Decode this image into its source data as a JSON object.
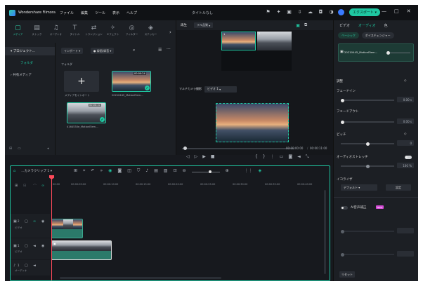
{
  "app": {
    "name": "Wondershare Filmora",
    "doc_title": "タイトルなし",
    "upgrade_label": "エクスポート"
  },
  "menu": [
    "ファイル",
    "編集",
    "ツール",
    "表示",
    "ヘルプ"
  ],
  "window_controls": [
    "—",
    "□",
    "✕"
  ],
  "toolbar_tools": [
    {
      "label": "メディア",
      "icon": "media-icon",
      "glyph": "▢"
    },
    {
      "label": "ストック",
      "icon": "stock-icon",
      "glyph": "▤"
    },
    {
      "label": "オーディオ",
      "icon": "audio-icon",
      "glyph": "♫"
    },
    {
      "label": "タイトル",
      "icon": "title-icon",
      "glyph": "T"
    },
    {
      "label": "トランジション",
      "icon": "transition-icon",
      "glyph": "⇄"
    },
    {
      "label": "エフェクト",
      "icon": "effects-icon",
      "glyph": "✧"
    },
    {
      "label": "フィルター",
      "icon": "filter-icon",
      "glyph": "◎"
    },
    {
      "label": "ステッカー",
      "icon": "sticker-icon",
      "glyph": "◈"
    }
  ],
  "library": {
    "project_label": "プロジェクト...",
    "folder_label": "フォルダ",
    "shared_label": "共有メディア",
    "import_label": "インポート",
    "record_label": "録画/録音",
    "folder_heading": "フォルダ",
    "import_tile_label": "メディアをインポート",
    "media": [
      {
        "name": "20210445_MotionElem...",
        "duration": "00:00:24"
      },
      {
        "name": "4164530e_MotionElem...",
        "duration": "00:00:10"
      }
    ]
  },
  "preview": {
    "tab_label": "再生",
    "quality": "フル品質",
    "multicam_label": "マルチカメラ撮影",
    "camera_select": "ビデオ 1",
    "cell_numbers": [
      "1",
      "2"
    ],
    "time_current": "00:00:00:00",
    "time_total": "00:00:11:00"
  },
  "right_panel": {
    "tabs": [
      "ビデオ",
      "オーディオ",
      "色"
    ],
    "subtabs": [
      "ベーシック",
      "ボイスチェンジャー"
    ],
    "clip_name": "20210445_MotionElem...",
    "adjust_label": "調整",
    "fade_in_label": "フェードイン",
    "fade_in_value": "0.00",
    "fade_out_label": "フェードアウト",
    "fade_out_value": "0.00",
    "pitch_label": "ピッチ",
    "pitch_value": "0",
    "stretch_label": "オーディオストレッチ",
    "stretch_value": "100",
    "eq_label": "イコライザ",
    "eq_value": "デフォルト",
    "eq_button": "設定",
    "ai_label": "AI音声補正",
    "ai_badge": "NEW",
    "reset_label": "リセット",
    "unit_s": "s",
    "unit_pct": "%"
  },
  "timeline": {
    "sequence_label": "...カメラクリップ 1",
    "ruler": [
      "00:00",
      "00:00:05:00",
      "00:00:10:00",
      "00:00:15:00",
      "00:00:20:00",
      "00:00:25:00",
      "00:00:30:00",
      "00:00:35:00",
      "00:00:40:00"
    ],
    "tracks": [
      {
        "num": "2",
        "label": "ビデオ"
      },
      {
        "num": "1",
        "label": "ビデオ"
      },
      {
        "num": "1",
        "label": "オーディオ"
      }
    ]
  },
  "colors": {
    "accent": "#1fc7a1",
    "playhead": "#ff4a5a",
    "background": "#17191e"
  }
}
